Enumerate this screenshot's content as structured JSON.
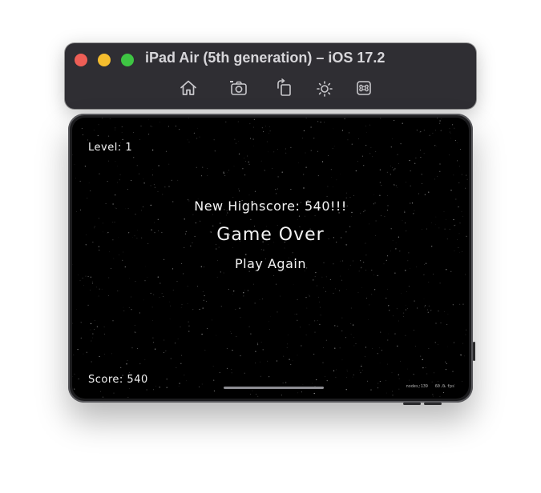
{
  "window": {
    "title": "iPad Air (5th generation) – iOS 17.2",
    "controls": [
      "close",
      "minimize",
      "zoom"
    ]
  },
  "toolbar": {
    "items": [
      {
        "icon": "home-icon",
        "label": "Home"
      },
      {
        "icon": "camera-icon",
        "label": "Screenshot"
      },
      {
        "icon": "rotate-icon",
        "label": "Rotate"
      },
      {
        "icon": "brightness-icon",
        "label": "Appearance"
      },
      {
        "icon": "command-icon",
        "label": "Keyboard"
      }
    ]
  },
  "game": {
    "level_label": "Level: 1",
    "highscore_text": "New Highscore: 540!!!",
    "game_over_text": "Game Over",
    "play_again_text": "Play Again",
    "score_label": "Score: 540",
    "debug": {
      "nodes": "nodes:139",
      "fps": "60.0 fps"
    }
  },
  "colors": {
    "toolbar_bg": "#2f2e33",
    "close": "#ee5e56",
    "minimize": "#f5bd2e",
    "zoom": "#3ec543",
    "screen_bg": "#000000",
    "text": "#f4f4f4"
  }
}
